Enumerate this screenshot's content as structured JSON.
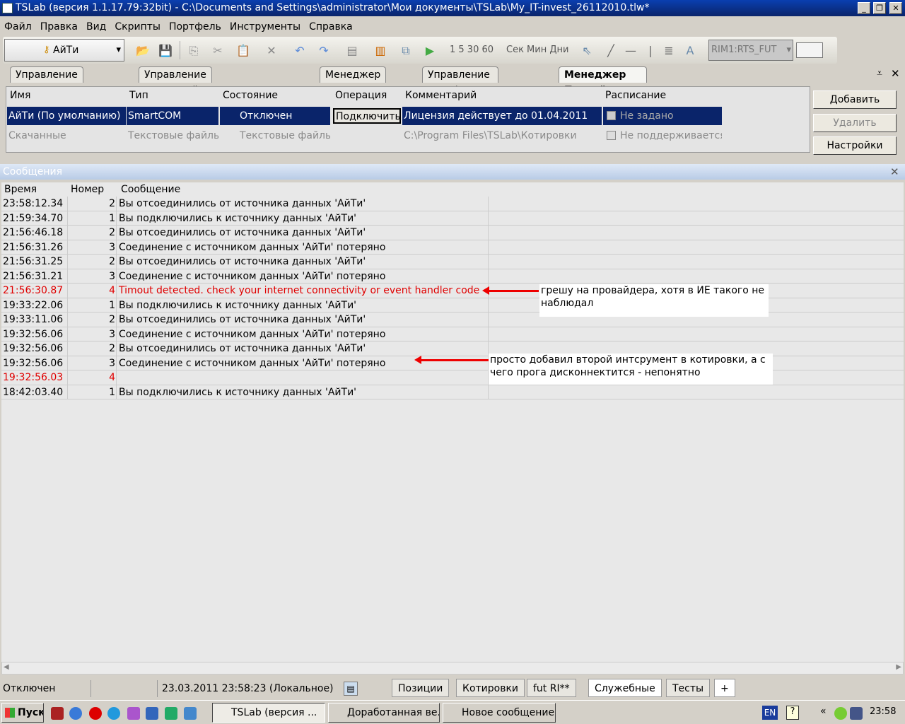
{
  "window": {
    "title": "TSLab (версия 1.1.17.79:32bit) - C:\\Documents and Settings\\administrator\\Мои документы\\TSLab\\My_IT-invest_26112010.tlw*"
  },
  "menu": [
    "Файл",
    "Правка",
    "Вид",
    "Скрипты",
    "Портфель",
    "Инструменты",
    "Справка"
  ],
  "toolbar": {
    "provider": "АйТи",
    "intervals": "1 5 30 60",
    "units": "Сек Мин Дни",
    "instrument": "RIM1:RTS_FUT"
  },
  "tabs": [
    "Управление скриптами",
    "Управление торговлей скриптами",
    "Менеджер команд",
    "Управление портфелями",
    "Менеджер Провайдеров Данных"
  ],
  "providers": {
    "headers": [
      "Имя",
      "Тип",
      "Состояние",
      "Операция",
      "Комментарий",
      "Расписание"
    ],
    "rows": [
      {
        "name": "АйТи (По умолчанию)",
        "type": "SmartCOM",
        "state": "Отключен",
        "op": "Подключить",
        "comment": "Лицензия действует до 01.04.2011",
        "schedule": "Не задано"
      },
      {
        "name": "Скачанные",
        "type": "Текстовые файлы",
        "state": "Текстовые файлы",
        "op": "",
        "comment": "C:\\Program Files\\TSLab\\Котировки",
        "schedule": "Не поддерживается"
      }
    ],
    "buttons": [
      "Добавить",
      "Удалить",
      "Настройки"
    ]
  },
  "messages": {
    "title": "Сообщения",
    "headers": [
      "Время",
      "Номер",
      "Сообщение"
    ],
    "rows": [
      {
        "time": "23:58:12.34",
        "num": "2",
        "text": "Вы отсоединились от источника данных 'АйТи'",
        "err": false
      },
      {
        "time": "21:59:34.70",
        "num": "1",
        "text": "Вы подключились к источнику данных 'АйТи'",
        "err": false
      },
      {
        "time": "21:56:46.18",
        "num": "2",
        "text": "Вы отсоединились от источника данных 'АйТи'",
        "err": false
      },
      {
        "time": "21:56:31.26",
        "num": "3",
        "text": "Соединение с источником данных 'АйТи' потеряно",
        "err": false
      },
      {
        "time": "21:56:31.25",
        "num": "2",
        "text": "Вы отсоединились от источника данных 'АйТи'",
        "err": false
      },
      {
        "time": "21:56:31.21",
        "num": "3",
        "text": "Соединение с источником данных 'АйТи' потеряно",
        "err": false
      },
      {
        "time": "21:56:30.87",
        "num": "4",
        "text": "Timout detected. check your  internet connectivity or event handler code",
        "err": true
      },
      {
        "time": "19:33:22.06",
        "num": "1",
        "text": "Вы подключились к источнику данных 'АйТи'",
        "err": false
      },
      {
        "time": "19:33:11.06",
        "num": "2",
        "text": "Вы отсоединились от источника данных 'АйТи'",
        "err": false
      },
      {
        "time": "19:32:56.06",
        "num": "3",
        "text": "Соединение с источником данных 'АйТи' потеряно",
        "err": false
      },
      {
        "time": "19:32:56.06",
        "num": "2",
        "text": "Вы отсоединились от источника данных 'АйТи'",
        "err": false
      },
      {
        "time": "19:32:56.06",
        "num": "3",
        "text": "Соединение с источником данных 'АйТи' потеряно",
        "err": false
      },
      {
        "time": "19:32:56.03",
        "num": "4",
        "text": "",
        "err": true
      },
      {
        "time": "18:42:03.40",
        "num": "1",
        "text": "Вы подключились к источнику данных 'АйТи'",
        "err": false
      }
    ]
  },
  "annotations": [
    "грешу на провайдера, хотя в ИЕ такого не наблюдал",
    "просто добавил второй интсрумент в котировки, а с чего прога дисконнектится - непонятно"
  ],
  "status": {
    "state": "Отключен",
    "datetime": "23.03.2011 23:58:23 (Локальное)"
  },
  "bottom_tabs": [
    "Позиции",
    "Котировки",
    "fut RI**",
    "Служебные",
    "Тесты",
    "+"
  ],
  "taskbar": {
    "start": "Пуск",
    "tasks": [
      "TSLab (версия ...",
      "Доработанная ве...",
      "Новое сообщение..."
    ],
    "lang": "EN",
    "clock": "23:58"
  }
}
